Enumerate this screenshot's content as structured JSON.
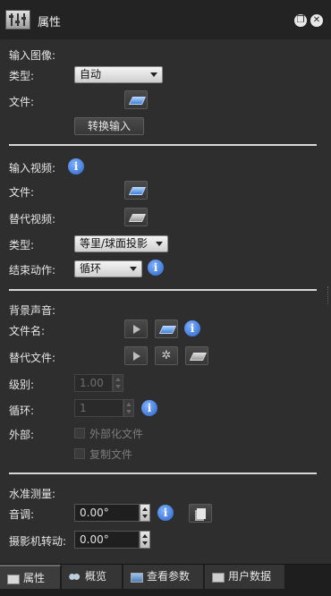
{
  "window": {
    "title": "属性"
  },
  "input_image": {
    "heading": "输入图像:",
    "type_label": "类型:",
    "type_value": "自动",
    "file_label": "文件:",
    "convert_button": "转换输入"
  },
  "input_video": {
    "heading": "输入视频:",
    "file_label": "文件:",
    "alt_video_label": "替代视频:",
    "type_label": "类型:",
    "type_value": "等里/球面投影",
    "end_action_label": "结束动作:",
    "end_action_value": "循环"
  },
  "background_audio": {
    "heading": "背景声音:",
    "filename_label": "文件名:",
    "alt_file_label": "替代文件:",
    "level_label": "级别:",
    "level_value": "1.00",
    "loop_label": "循环:",
    "loop_value": "1",
    "external_label": "外部:",
    "externalize_label": "外部化文件",
    "copy_file_label": "复制文件"
  },
  "level_measure": {
    "heading": "水准测量:",
    "pitch_label": "音调:",
    "pitch_value": "0.00°",
    "camera_roll_label": "摄影机转动:",
    "camera_roll_value": "0.00°"
  },
  "tabs": [
    {
      "label": "属性"
    },
    {
      "label": "概览"
    },
    {
      "label": "查看参数"
    },
    {
      "label": "用户数据"
    }
  ],
  "colors": {
    "info_blue": "#2b62c8",
    "folder_blue": "#3f7fd8",
    "panel_bg": "#2e2e2e"
  }
}
